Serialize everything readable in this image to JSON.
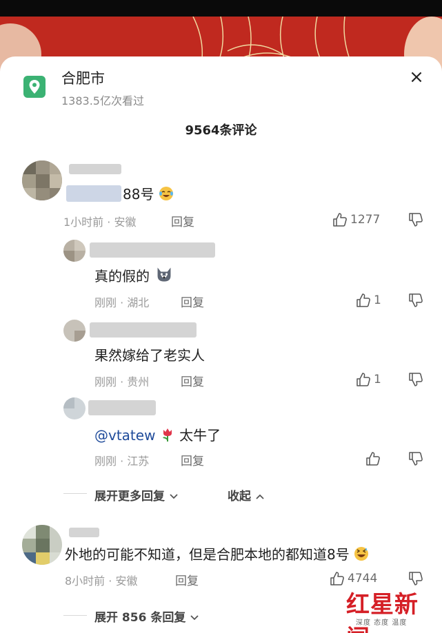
{
  "header": {
    "location_title": "合肥市",
    "location_views": "1383.5亿次看过",
    "close_symbol": "×",
    "comment_count": "9564条评论"
  },
  "comments": [
    {
      "text_suffix": "88号",
      "emoji": "laughing-tears",
      "time_loc": "1小时前 · 安徽",
      "reply_label": "回复",
      "likes": "1277",
      "replies": [
        {
          "text": "真的假的",
          "emoji": "husky-dog",
          "time_loc": "刚刚 · 湖北",
          "reply_label": "回复",
          "likes": "1"
        },
        {
          "text": "果然嫁给了老实人",
          "time_loc": "刚刚 · 贵州",
          "reply_label": "回复",
          "likes": "1"
        },
        {
          "mention": "@vtatew",
          "emoji": "tulip",
          "text": "太牛了",
          "time_loc": "刚刚 · 江苏",
          "reply_label": "回复",
          "likes": ""
        }
      ],
      "expand_more": "展开更多回复",
      "collapse": "收起"
    },
    {
      "text": "外地的可能不知道，但是合肥本地的都知道8号",
      "emoji": "laughing-sweat",
      "time_loc": "8小时前 · 安徽",
      "reply_label": "回复",
      "likes": "4744",
      "expand_replies": "展开 856 条回复"
    }
  ],
  "watermark": {
    "main": "红星新闻",
    "sub": "深度 态度 温度"
  },
  "colors": {
    "location_icon": "#3bb273",
    "watermark_red": "#d51f26",
    "video_bg": "#c0291f"
  }
}
